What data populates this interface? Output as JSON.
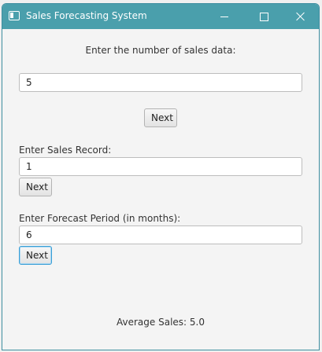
{
  "window": {
    "title": "Sales Forecasting System"
  },
  "form": {
    "count_prompt": "Enter the number of sales data:",
    "count_value": "5",
    "count_next_label": "Next",
    "record_label": "Enter Sales Record:",
    "record_value": "1",
    "record_next_label": "Next",
    "period_label": "Enter Forecast Period (in months):",
    "period_value": "6",
    "period_next_label": "Next"
  },
  "result": {
    "average_text": "Average Sales: 5.0"
  },
  "icons": {
    "app": "app-window-icon",
    "minimize": "minimize-icon",
    "maximize": "maximize-icon",
    "close": "close-icon"
  },
  "colors": {
    "titlebar": "#4a9fac",
    "focus_ring": "#3a9fd6"
  }
}
